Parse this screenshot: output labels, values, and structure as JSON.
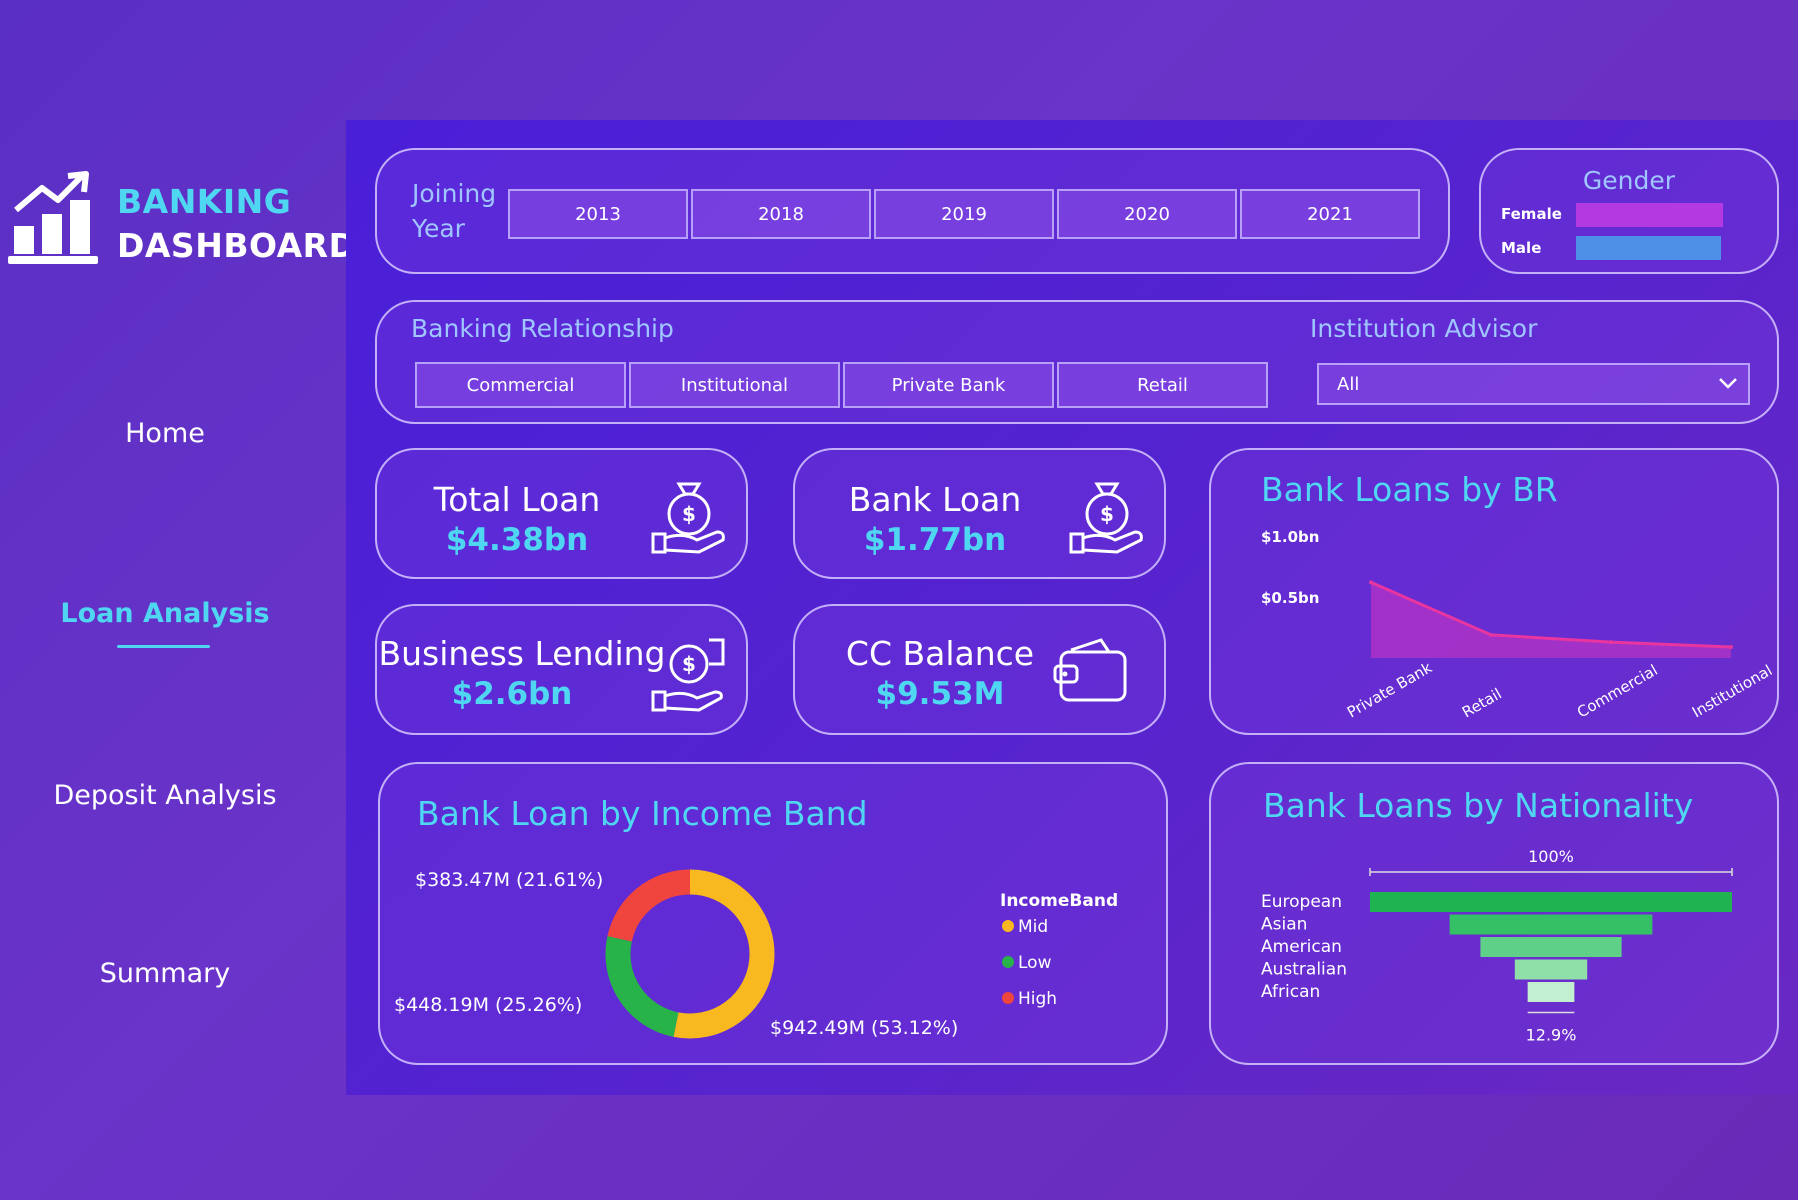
{
  "sidebar": {
    "logo_line1": "BANKING",
    "logo_line2": "DASHBOARD",
    "nav": [
      "Home",
      "Loan Analysis",
      "Deposit Analysis",
      "Summary"
    ],
    "active": "Loan Analysis"
  },
  "filters": {
    "joining_year_label": "Joining Year",
    "years": [
      "2013",
      "2018",
      "2019",
      "2020",
      "2021"
    ],
    "gender": {
      "title": "Gender",
      "female": "Female",
      "male": "Male"
    },
    "br_title": "Banking Relationship",
    "relationships": [
      "Commercial",
      "Institutional",
      "Private Bank",
      "Retail"
    ],
    "advisor_title": "Institution Advisor",
    "advisor_value": "All"
  },
  "kpis": {
    "total_loan": {
      "label": "Total Loan",
      "value": "$4.38bn"
    },
    "bank_loan": {
      "label": "Bank Loan",
      "value": "$1.77bn"
    },
    "business_lending": {
      "label": "Business Lending",
      "value": "$2.6bn"
    },
    "cc_balance": {
      "label": "CC Balance",
      "value": "$9.53M"
    }
  },
  "colors": {
    "accent": "#4fd7f2",
    "female": "#b23ae0",
    "male": "#4e8fe8",
    "mid": "#f8b81f",
    "low": "#27b34a",
    "high": "#f0453f",
    "area": "#b533c4"
  },
  "chart_data": [
    {
      "type": "area",
      "title": "Bank Loans by BR",
      "categories": [
        "Private Bank",
        "Retail",
        "Commercial",
        "Institutional"
      ],
      "values": [
        0.62,
        0.19,
        0.13,
        0.09
      ],
      "y_ticks": [
        "$1.0bn",
        "$0.5bn"
      ],
      "ylim": [
        0,
        1.0
      ]
    },
    {
      "type": "pie",
      "title": "Bank Loan by Income Band",
      "legend_title": "IncomeBand",
      "slices": [
        {
          "name": "Mid",
          "value": 942.49,
          "label": "$942.49M (53.12%)"
        },
        {
          "name": "Low",
          "value": 448.19,
          "label": "$448.19M (25.26%)"
        },
        {
          "name": "High",
          "value": 383.47,
          "label": "$383.47M (21.61%)"
        }
      ]
    },
    {
      "type": "bar",
      "title": "Bank Loans by Nationality",
      "categories": [
        "European",
        "Asian",
        "American",
        "Australian",
        "African"
      ],
      "values": [
        100,
        56,
        39,
        20,
        12.9
      ],
      "top_label": "100%",
      "bottom_label": "12.9%"
    }
  ]
}
